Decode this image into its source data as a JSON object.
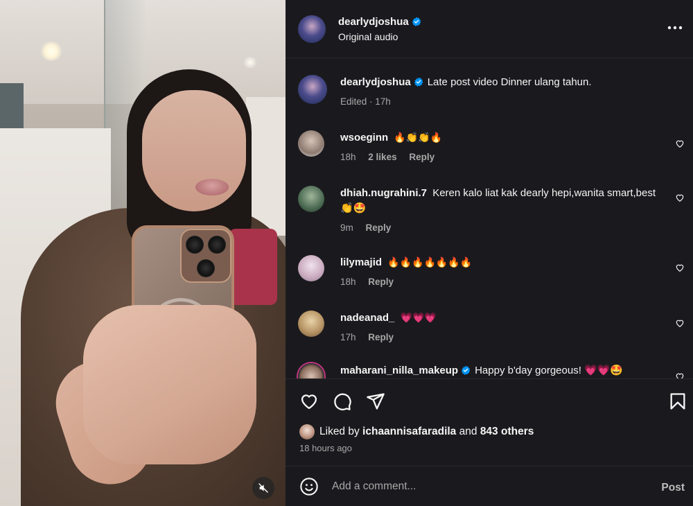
{
  "header": {
    "username": "dearlydjoshua",
    "subtitle": "Original audio",
    "more_icon": "more-horizontal-icon"
  },
  "caption": {
    "username": "dearlydjoshua",
    "text": "Late post video Dinner ulang tahun.",
    "meta": "Edited · 17h"
  },
  "comments": [
    {
      "username": "wsoeginn",
      "text": "🔥👏👏🔥",
      "time": "18h",
      "likes": "2 likes",
      "reply": "Reply"
    },
    {
      "username": "dhiah.nugrahini.7",
      "text": "Keren kalo liat kak dearly hepi,wanita smart,best 👏🤩",
      "time": "9m",
      "likes": "",
      "reply": "Reply"
    },
    {
      "username": "lilymajid",
      "text": "🔥🔥🔥🔥🔥🔥🔥",
      "time": "18h",
      "likes": "",
      "reply": "Reply"
    },
    {
      "username": "nadeanad_",
      "text": "💗💗💗",
      "time": "17h",
      "likes": "",
      "reply": "Reply"
    },
    {
      "username": "maharani_nilla_makeup",
      "text": "Happy b'day gorgeous! 💗💗🤩",
      "time": "",
      "likes": "",
      "reply": ""
    }
  ],
  "likes": {
    "prefix": "Liked by",
    "user": "ichaannisafaradila",
    "middle": "and",
    "others": "843 others"
  },
  "timestamp": "18 hours ago",
  "comment_box": {
    "placeholder": "Add a comment...",
    "post_label": "Post"
  },
  "colors": {
    "panel_bg": "#1a1a1e",
    "text": "#f5f5f5",
    "muted": "#a8a8a8",
    "verified": "#0095f6"
  }
}
